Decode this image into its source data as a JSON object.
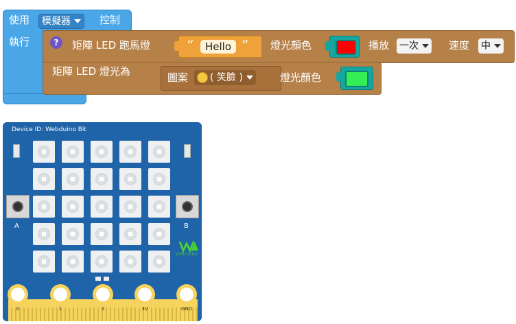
{
  "blocks": {
    "control": {
      "label_use": "使用",
      "mode_dropdown": "模擬器",
      "label_control": "控制",
      "label_execute": "執行"
    },
    "marquee": {
      "help_icon": "?",
      "label": "矩陣 LED 跑馬燈",
      "quote_open": "“",
      "text_value": "Hello",
      "quote_close": "”",
      "color_label": "燈光顏色",
      "color_value": "#ff0000",
      "play_label": "播放",
      "play_dropdown": "一次",
      "speed_label": "速度",
      "speed_dropdown": "中"
    },
    "matrix_light": {
      "label": "矩陣 LED 燈光為",
      "pattern_label": "圖案",
      "pattern_dropdown": "( 笑臉 )",
      "color_label": "燈光顏色",
      "color_value": "#33ee55"
    }
  },
  "board": {
    "device_id_label": "Device ID:",
    "device_id_value": "Webduino Bit",
    "button_a_label": "A",
    "button_b_label": "B",
    "brand_text": "WEBDUINO",
    "pins": [
      "0",
      "1",
      "2",
      "3V",
      "GND"
    ]
  },
  "colors": {
    "block_blue": "#4aa6e6",
    "block_brown": "#b68149",
    "board_blue": "#1f63a8",
    "pin_gold": "#f5d35d",
    "brand_green": "#48d038"
  }
}
